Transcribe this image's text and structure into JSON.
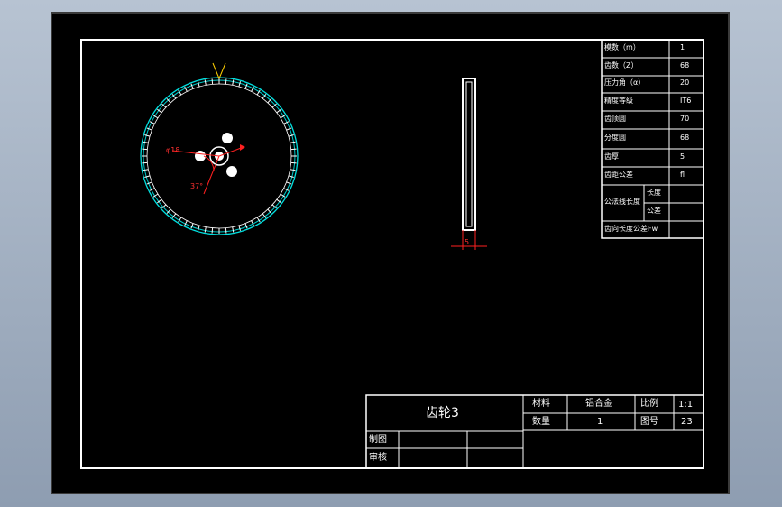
{
  "params": [
    {
      "label": "模数（m）",
      "value": "1"
    },
    {
      "label": "齿数（Z）",
      "value": "68"
    },
    {
      "label": "压力角（α）",
      "value": "20"
    },
    {
      "label": "精度等级",
      "value": "IT6"
    },
    {
      "label": "齿顶圆",
      "value": "70"
    },
    {
      "label": "分度圆",
      "value": "68"
    },
    {
      "label": "齿厚",
      "value": "5"
    },
    {
      "label": "齿距公差",
      "value": "fl"
    },
    {
      "label": "公法线长度",
      "value": "长度"
    },
    {
      "label": "公差",
      "value": "公差"
    },
    {
      "label": "齿向长度公差Fw",
      "value": ""
    }
  ],
  "title_block": {
    "part_name": "齿轮3",
    "material_label": "材料",
    "material_value": "铝合金",
    "scale_label": "比例",
    "scale_value": "1:1",
    "qty_label": "数量",
    "qty_value": "1",
    "drawing_no_label": "图号",
    "drawing_no_value": "23",
    "drawn_label": "制图",
    "check_label": "审核"
  },
  "dims": {
    "side_thickness": "5",
    "bolt_circle": "φ18",
    "angle": "37°"
  },
  "colors": {
    "background": "#000000",
    "frame": "#ffffff",
    "gear_outline": "#00e0e0",
    "dimension": "#ff2020",
    "crosshair": "#ffd000"
  }
}
